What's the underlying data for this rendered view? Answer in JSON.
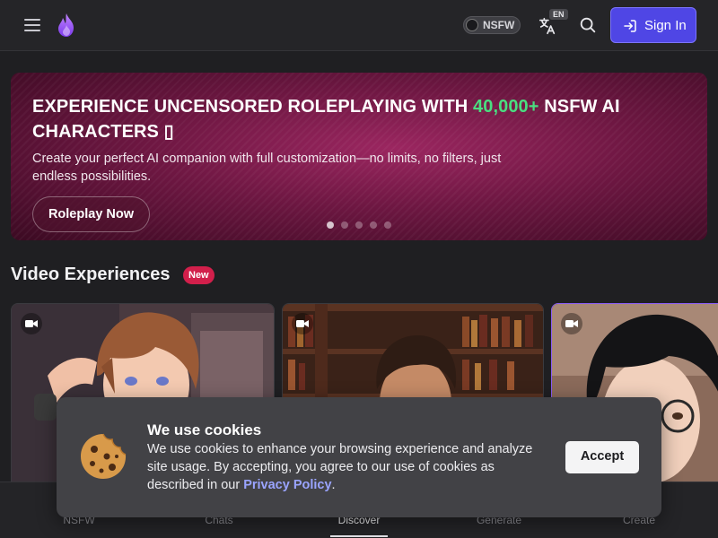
{
  "header": {
    "menu_icon": "hamburger-menu-icon",
    "logo_icon": "flame-logo-icon",
    "nsfw_toggle_label": "NSFW",
    "language_badge": "EN",
    "language_icon": "translate-icon",
    "search_icon": "search-icon",
    "signin_label": "Sign In",
    "signin_icon": "login-arrow-icon",
    "accent_color": "#4f46e5"
  },
  "hero": {
    "title_part1": "EXPERIENCE UNCENSORED ROLEPLAYING WITH ",
    "title_accent": "40,000+",
    "title_part2": " NSFW AI CHARACTERS ",
    "title_trailing_glyph": "▯",
    "subtitle": "Create your perfect AI companion with full customization—no limits, no filters, just endless possibilities.",
    "cta_label": "Roleplay Now",
    "slide_count": 5,
    "active_slide": 1
  },
  "section": {
    "title": "Video Experiences",
    "badge": "New"
  },
  "cards": [
    {
      "icon": "video-camera-icon",
      "subject": "anime-boy"
    },
    {
      "icon": "video-camera-icon",
      "subject": "library-man"
    },
    {
      "icon": "video-camera-icon",
      "subject": "woman-glasses"
    }
  ],
  "bottom_nav": {
    "items": [
      "NSFW",
      "Chats",
      "Discover",
      "Generate",
      "Create"
    ],
    "active": "Discover"
  },
  "cookie_banner": {
    "title": "We use cookies",
    "text": "We use cookies to enhance your browsing experience and analyze site usage. By accepting, you agree to our use of cookies as described in our ",
    "link_text": "Privacy Policy",
    "text_end": ".",
    "accept_label": "Accept",
    "icon": "cookie-icon"
  }
}
